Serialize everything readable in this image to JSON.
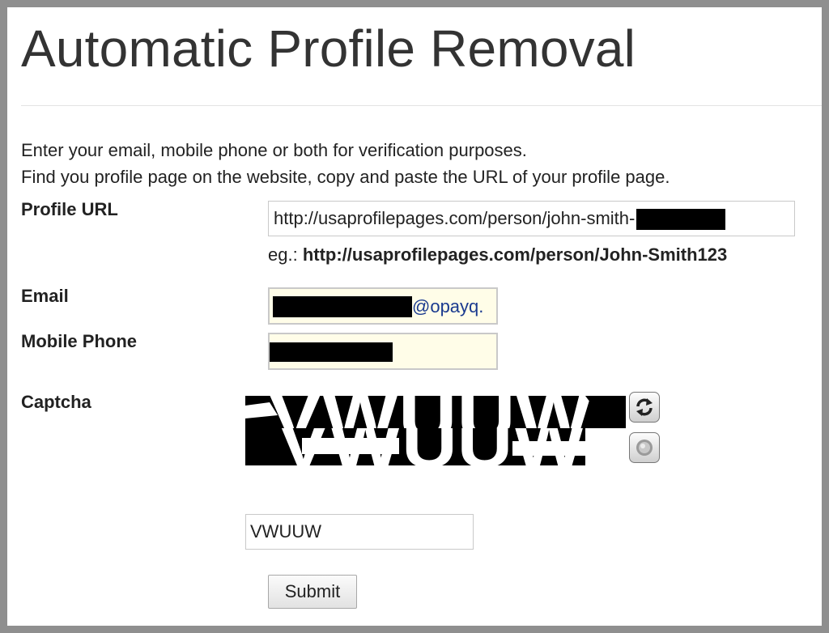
{
  "page": {
    "title": "Automatic Profile Removal",
    "intro_line1": "Enter your email, mobile phone or both for verification purposes.",
    "intro_line2": "Find you profile page on the website, copy and paste the URL of your profile page."
  },
  "form": {
    "profile_url": {
      "label": "Profile URL",
      "value": "http://usaprofilepages.com/person/john-smith-",
      "example_prefix": "eg.:",
      "example_url": "http://usaprofilepages.com/person/John-Smith123"
    },
    "email": {
      "label": "Email",
      "value_visible": "@opayq."
    },
    "mobile_phone": {
      "label": "Mobile Phone",
      "value_visible": ""
    },
    "captcha": {
      "label": "Captcha",
      "image_text": "VWUUW",
      "refresh_icon": "refresh-icon",
      "audio_icon": "speaker-icon",
      "value": "VWUUW"
    },
    "submit_label": "Submit"
  },
  "colors": {
    "border_frame": "#8f8f8f",
    "field_highlight": "#fffde8",
    "email_domain_text": "#1a3a8f",
    "redaction": "#000000"
  }
}
